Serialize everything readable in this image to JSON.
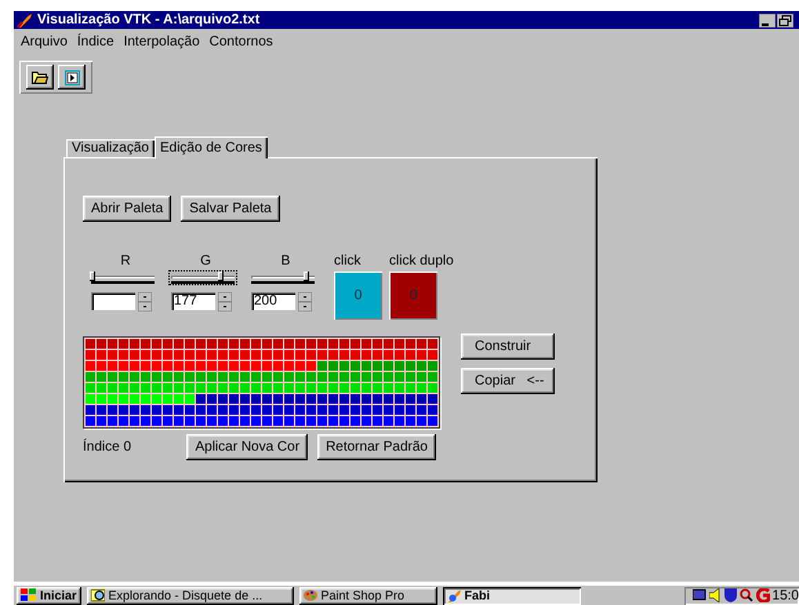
{
  "window": {
    "title": "Visualização VTK - A:\\arquivo2.txt"
  },
  "menu": [
    "Arquivo",
    "Índice",
    "Interpolação",
    "Contornos"
  ],
  "toolbar": [
    {
      "kind": "open"
    },
    {
      "kind": "run"
    }
  ],
  "tabs": [
    {
      "label": "Visualização",
      "selected": false
    },
    {
      "label": "Edição de Cores",
      "selected": true
    }
  ],
  "palette_buttons": [
    "Abrir Paleta",
    "Salvar Paleta"
  ],
  "channels": [
    {
      "name": "R",
      "level": 0,
      "focused": false
    },
    {
      "name": "G",
      "level": 0.75,
      "focused": true,
      "value": "177"
    },
    {
      "name": "B",
      "level": 0.85,
      "focused": false,
      "value": "200"
    }
  ],
  "swatches": [
    {
      "label": "click",
      "value": "0",
      "color": "#00a8c8"
    },
    {
      "label": "click duplo",
      "value": "0",
      "color": "#a00000"
    }
  ],
  "palette": {
    "rows": [
      {
        "cells": [
          {
            "color": "#c00000"
          },
          {
            "color": "#c00000"
          },
          {
            "color": "#c00000"
          },
          {
            "color": "#c00000"
          },
          {
            "color": "#c00000"
          },
          {
            "color": "#c00000"
          },
          {
            "color": "#c00000"
          },
          {
            "color": "#c00000"
          },
          {
            "color": "#c00000"
          },
          {
            "color": "#c00000"
          },
          {
            "color": "#c00000"
          },
          {
            "color": "#c00000"
          },
          {
            "color": "#c00000"
          },
          {
            "color": "#c00000"
          },
          {
            "color": "#c00000"
          },
          {
            "color": "#c00000"
          },
          {
            "color": "#c00000"
          },
          {
            "color": "#c00000"
          },
          {
            "color": "#c00000"
          },
          {
            "color": "#c00000"
          },
          {
            "color": "#c00000"
          },
          {
            "color": "#c00000"
          },
          {
            "color": "#c00000"
          },
          {
            "color": "#c00000"
          },
          {
            "color": "#c00000"
          },
          {
            "color": "#c00000"
          },
          {
            "color": "#c00000"
          },
          {
            "color": "#c00000"
          },
          {
            "color": "#c00000"
          },
          {
            "color": "#c00000"
          },
          {
            "color": "#c00000"
          },
          {
            "color": "#c00000"
          }
        ]
      },
      {
        "cells": [
          {
            "color": "#e80000"
          },
          {
            "color": "#e80000"
          },
          {
            "color": "#e80000"
          },
          {
            "color": "#e80000"
          },
          {
            "color": "#e80000"
          },
          {
            "color": "#e80000"
          },
          {
            "color": "#e80000"
          },
          {
            "color": "#e80000"
          },
          {
            "color": "#e80000"
          },
          {
            "color": "#e80000"
          },
          {
            "color": "#e80000"
          },
          {
            "color": "#e80000"
          },
          {
            "color": "#e80000"
          },
          {
            "color": "#e80000"
          },
          {
            "color": "#e80000"
          },
          {
            "color": "#e80000"
          },
          {
            "color": "#e80000"
          },
          {
            "color": "#e80000"
          },
          {
            "color": "#e80000"
          },
          {
            "color": "#e80000"
          },
          {
            "color": "#e80000"
          },
          {
            "color": "#e80000"
          },
          {
            "color": "#e80000"
          },
          {
            "color": "#e80000"
          },
          {
            "color": "#e80000"
          },
          {
            "color": "#e80000"
          },
          {
            "color": "#e80000"
          },
          {
            "color": "#e80000"
          },
          {
            "color": "#e80000"
          },
          {
            "color": "#e80000"
          },
          {
            "color": "#e80000"
          },
          {
            "color": "#e80000"
          }
        ]
      },
      {
        "cells": [
          {
            "color": "#ff0000"
          },
          {
            "color": "#ff0000"
          },
          {
            "color": "#ff0000"
          },
          {
            "color": "#ff0000"
          },
          {
            "color": "#ff0000"
          },
          {
            "color": "#ff0000"
          },
          {
            "color": "#ff0000"
          },
          {
            "color": "#ff0000"
          },
          {
            "color": "#ff0000"
          },
          {
            "color": "#ff0000"
          },
          {
            "color": "#ff0000"
          },
          {
            "color": "#ff0000"
          },
          {
            "color": "#ff0000"
          },
          {
            "color": "#ff0000"
          },
          {
            "color": "#ff0000"
          },
          {
            "color": "#ff0000"
          },
          {
            "color": "#ff0000"
          },
          {
            "color": "#ff0000"
          },
          {
            "color": "#ff0000"
          },
          {
            "color": "#ff0000"
          },
          {
            "color": "#ff0000"
          },
          {
            "color": "#00a000"
          },
          {
            "color": "#00a000"
          },
          {
            "color": "#00a000"
          },
          {
            "color": "#00a000"
          },
          {
            "color": "#00a000"
          },
          {
            "color": "#00a000"
          },
          {
            "color": "#00a000"
          },
          {
            "color": "#00a000"
          },
          {
            "color": "#00a000"
          },
          {
            "color": "#00a000"
          },
          {
            "color": "#00a000"
          }
        ]
      },
      {
        "cells": [
          {
            "color": "#00b400"
          },
          {
            "color": "#00b400"
          },
          {
            "color": "#00b400"
          },
          {
            "color": "#00b400"
          },
          {
            "color": "#00b400"
          },
          {
            "color": "#00b400"
          },
          {
            "color": "#00b400"
          },
          {
            "color": "#00b400"
          },
          {
            "color": "#00b400"
          },
          {
            "color": "#00b400"
          },
          {
            "color": "#00b400"
          },
          {
            "color": "#00b400"
          },
          {
            "color": "#00b400"
          },
          {
            "color": "#00b400"
          },
          {
            "color": "#00b400"
          },
          {
            "color": "#00b400"
          },
          {
            "color": "#00b400"
          },
          {
            "color": "#00b400"
          },
          {
            "color": "#00b400"
          },
          {
            "color": "#00b400"
          },
          {
            "color": "#00b400"
          },
          {
            "color": "#00b400"
          },
          {
            "color": "#00b400"
          },
          {
            "color": "#00b400"
          },
          {
            "color": "#00b400"
          },
          {
            "color": "#00b400"
          },
          {
            "color": "#00b400"
          },
          {
            "color": "#00b400"
          },
          {
            "color": "#00b400"
          },
          {
            "color": "#00b400"
          },
          {
            "color": "#00b400"
          },
          {
            "color": "#00b400"
          }
        ]
      },
      {
        "cells": [
          {
            "color": "#00e000"
          },
          {
            "color": "#00e000"
          },
          {
            "color": "#00e000"
          },
          {
            "color": "#00e000"
          },
          {
            "color": "#00e000"
          },
          {
            "color": "#00e000"
          },
          {
            "color": "#00e000"
          },
          {
            "color": "#00e000"
          },
          {
            "color": "#00e000"
          },
          {
            "color": "#00e000"
          },
          {
            "color": "#00e000"
          },
          {
            "color": "#00e000"
          },
          {
            "color": "#00e000"
          },
          {
            "color": "#00e000"
          },
          {
            "color": "#00e000"
          },
          {
            "color": "#00e000"
          },
          {
            "color": "#00e000"
          },
          {
            "color": "#00e000"
          },
          {
            "color": "#00e000"
          },
          {
            "color": "#00e000"
          },
          {
            "color": "#00e000"
          },
          {
            "color": "#00e000"
          },
          {
            "color": "#00e000"
          },
          {
            "color": "#00e000"
          },
          {
            "color": "#00e000"
          },
          {
            "color": "#00e000"
          },
          {
            "color": "#00e000"
          },
          {
            "color": "#00e000"
          },
          {
            "color": "#00e000"
          },
          {
            "color": "#00e000"
          },
          {
            "color": "#00e000"
          },
          {
            "color": "#00e000"
          }
        ]
      },
      {
        "cells": [
          {
            "color": "#00ff00"
          },
          {
            "color": "#00ff00"
          },
          {
            "color": "#00ff00"
          },
          {
            "color": "#00ff00"
          },
          {
            "color": "#00ff00"
          },
          {
            "color": "#00ff00"
          },
          {
            "color": "#00ff00"
          },
          {
            "color": "#00ff00"
          },
          {
            "color": "#00ff00"
          },
          {
            "color": "#00ff00"
          },
          {
            "color": "#0000b0"
          },
          {
            "color": "#0000b0"
          },
          {
            "color": "#0000b0"
          },
          {
            "color": "#0000b0"
          },
          {
            "color": "#0000b0"
          },
          {
            "color": "#0000b0"
          },
          {
            "color": "#0000b0"
          },
          {
            "color": "#0000b0"
          },
          {
            "color": "#0000b0"
          },
          {
            "color": "#0000b0"
          },
          {
            "color": "#0000b0"
          },
          {
            "color": "#0000b0"
          },
          {
            "color": "#0000b0"
          },
          {
            "color": "#0000b0"
          },
          {
            "color": "#0000b0"
          },
          {
            "color": "#0000b0"
          },
          {
            "color": "#0000b0"
          },
          {
            "color": "#0000b0"
          },
          {
            "color": "#0000b0"
          },
          {
            "color": "#0000b0"
          },
          {
            "color": "#0000b0"
          },
          {
            "color": "#0000b0"
          }
        ]
      },
      {
        "cells": [
          {
            "color": "#0000c8"
          },
          {
            "color": "#0000c8"
          },
          {
            "color": "#0000c8"
          },
          {
            "color": "#0000c8"
          },
          {
            "color": "#0000c8"
          },
          {
            "color": "#0000c8"
          },
          {
            "color": "#0000c8"
          },
          {
            "color": "#0000c8"
          },
          {
            "color": "#0000c8"
          },
          {
            "color": "#0000c8"
          },
          {
            "color": "#0000c8"
          },
          {
            "color": "#0000c8"
          },
          {
            "color": "#0000c8"
          },
          {
            "color": "#0000c8"
          },
          {
            "color": "#0000c8"
          },
          {
            "color": "#0000c8"
          },
          {
            "color": "#0000c8"
          },
          {
            "color": "#0000c8"
          },
          {
            "color": "#0000c8"
          },
          {
            "color": "#0000c8"
          },
          {
            "color": "#0000c8"
          },
          {
            "color": "#0000c8"
          },
          {
            "color": "#0000c8"
          },
          {
            "color": "#0000c8"
          },
          {
            "color": "#0000c8"
          },
          {
            "color": "#0000c8"
          },
          {
            "color": "#0000c8"
          },
          {
            "color": "#0000c8"
          },
          {
            "color": "#0000c8"
          },
          {
            "color": "#0000c8"
          },
          {
            "color": "#0000c8"
          },
          {
            "color": "#0000c8"
          }
        ]
      },
      {
        "cells": [
          {
            "color": "#0000ff"
          },
          {
            "color": "#0000ff"
          },
          {
            "color": "#0000ff"
          },
          {
            "color": "#0000ff"
          },
          {
            "color": "#0000ff"
          },
          {
            "color": "#0000ff"
          },
          {
            "color": "#0000ff"
          },
          {
            "color": "#0000ff"
          },
          {
            "color": "#0000ff"
          },
          {
            "color": "#0000ff"
          },
          {
            "color": "#0000ff"
          },
          {
            "color": "#0000ff"
          },
          {
            "color": "#0000ff"
          },
          {
            "color": "#0000ff"
          },
          {
            "color": "#0000ff"
          },
          {
            "color": "#0000ff"
          },
          {
            "color": "#0000ff"
          },
          {
            "color": "#0000ff"
          },
          {
            "color": "#0000ff"
          },
          {
            "color": "#0000ff"
          },
          {
            "color": "#0000ff"
          },
          {
            "color": "#0000ff"
          },
          {
            "color": "#0000ff"
          },
          {
            "color": "#0000ff"
          },
          {
            "color": "#0000ff"
          },
          {
            "color": "#0000ff"
          },
          {
            "color": "#0000ff"
          },
          {
            "color": "#0000ff"
          },
          {
            "color": "#0000ff"
          },
          {
            "color": "#0000ff"
          },
          {
            "color": "#0000ff"
          },
          {
            "color": "#0000ff"
          }
        ]
      }
    ]
  },
  "side_buttons": [
    "Construir",
    "Copiar   <--"
  ],
  "index_label": "Índice 0",
  "bottom_buttons": [
    "Aplicar Nova Cor",
    "Retornar Padrão"
  ],
  "taskbar": {
    "start": "Iniciar",
    "tasks": [
      {
        "label": "Explorando - Disquete de ...",
        "selected": false,
        "kind": "explorer"
      },
      {
        "label": "Paint Shop Pro",
        "selected": false,
        "kind": "paint"
      },
      {
        "label": "Fabi",
        "selected": true,
        "kind": "app"
      }
    ],
    "clock": "15:0"
  }
}
